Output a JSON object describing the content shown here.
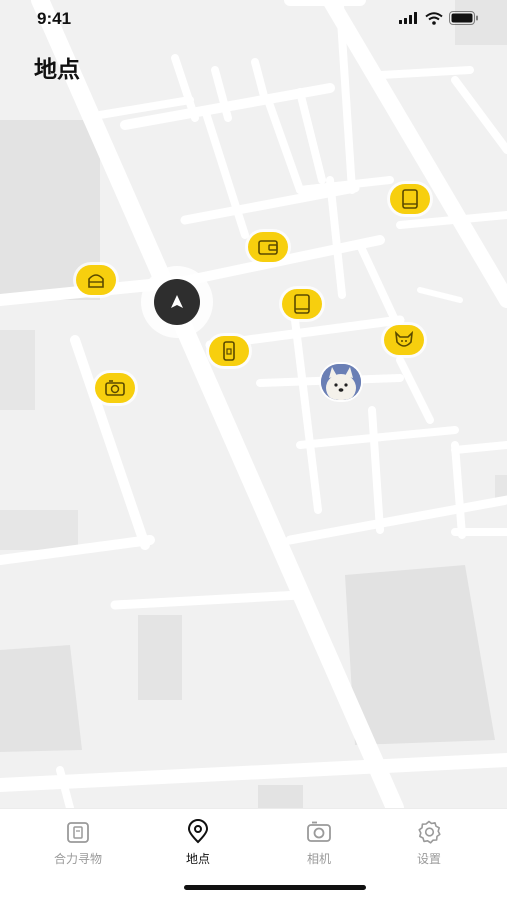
{
  "status_bar": {
    "time": "9:41"
  },
  "header": {
    "title": "地点"
  },
  "map": {
    "pins": [
      {
        "name": "tablet-pin",
        "icon": "tablet-icon"
      },
      {
        "name": "wallet-pin",
        "icon": "wallet-icon"
      },
      {
        "name": "bag-pin",
        "icon": "bag-icon"
      },
      {
        "name": "tablet-pin-2",
        "icon": "tablet-icon"
      },
      {
        "name": "phone-pin",
        "icon": "phone-icon"
      },
      {
        "name": "pet-pin",
        "icon": "pet-icon"
      },
      {
        "name": "camera-pin",
        "icon": "camera-icon"
      }
    ],
    "accent_color": "#f7cf0e"
  },
  "tabbar": {
    "tabs": [
      {
        "label": "合力寻物",
        "icon": "clipboard-icon",
        "active": false
      },
      {
        "label": "地点",
        "icon": "location-pin-icon",
        "active": true
      },
      {
        "label": "相机",
        "icon": "camera-icon",
        "active": false
      },
      {
        "label": "设置",
        "icon": "gear-icon",
        "active": false
      }
    ]
  }
}
